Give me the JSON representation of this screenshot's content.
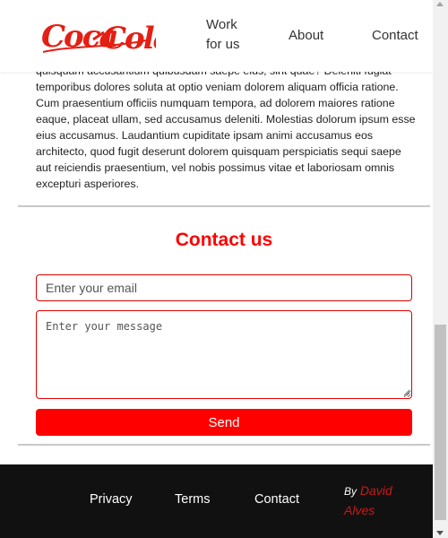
{
  "header": {
    "brand": "Coca-Cola",
    "nav": {
      "work": "Work for us",
      "about": "About",
      "contact": "Contact"
    }
  },
  "content": {
    "paragraph": "quisquam accusantium quibusdam saepe eius, sint quae? Deleniti fugiat temporibus dolores soluta at optio veniam dolorem aliquam officia ratione. Cum praesentium officiis numquam tempora, ad dolorem maiores ratione eaque, placeat ullam, sed accusamus deleniti. Molestias dolorum ipsum esse eius accusamus. Laudantium cupiditate ipsam animi accusamus eos architecto, quod fugit deserunt dolorem quisquam perspiciatis sequi saepe aut reiciendis praesentium, vel nobis possimus vitae et laboriosam omnis excepturi asperiores."
  },
  "contact": {
    "title": "Contact us",
    "email_placeholder": "Enter your email",
    "message_placeholder": "Enter your message",
    "send_label": "Send"
  },
  "footer": {
    "privacy": "Privacy",
    "terms": "Terms",
    "contact": "Contact",
    "by": "By",
    "author": "David Alves"
  },
  "colors": {
    "accent": "#ff0000",
    "brand": "#e41f13",
    "footer_bg": "#111111"
  },
  "icons": {
    "scroll_up": "chevron-up-icon",
    "scroll_down": "chevron-down-icon",
    "resize": "resize-grip-icon"
  }
}
